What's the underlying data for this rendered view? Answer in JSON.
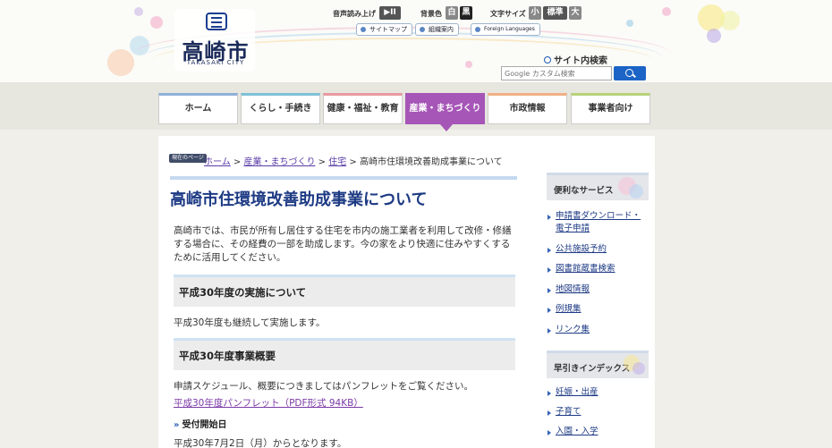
{
  "header": {
    "logo_jp": "高崎市",
    "logo_en": "TAKASAKI CITY",
    "utilities": {
      "speech_label": "音声読み上げ",
      "speech_btn": "▶II",
      "bg_label": "背景色",
      "bg_white": "白",
      "bg_black": "黒",
      "font_label": "文字サイズ",
      "font_small": "小",
      "font_std": "標準",
      "font_large": "大"
    },
    "links": [
      "サイトマップ",
      "組織案内",
      "Foreign Languages"
    ],
    "search_title": "サイト内検索",
    "search_placeholder": "Google カスタム検索"
  },
  "nav": [
    {
      "label": "ホーム",
      "color": "#8fb1d8"
    },
    {
      "label": "くらし・手続き",
      "color": "#7fc0d6"
    },
    {
      "label": "健康・福祉・教育",
      "color": "#e99aa0"
    },
    {
      "label": "産業・まちづくり",
      "color": "#a656b7",
      "active": true
    },
    {
      "label": "市政情報",
      "color": "#efb083"
    },
    {
      "label": "事業者向け",
      "color": "#b9d27a"
    }
  ],
  "breadcrumb": {
    "badge": "現在のページ",
    "items": [
      "ホーム",
      "産業・まちづくり",
      "住宅"
    ],
    "current": "高崎市住環境改善助成事業について"
  },
  "content": {
    "title": "高崎市住環境改善助成事業について",
    "intro": "高崎市では、市民が所有し居住する住宅を市内の施工業者を利用して改修・修繕する場合に、その経費の一部を助成します。今の家をより快適に住みやすくするために活用してください。",
    "section1_title": "平成30年度の実施について",
    "section1_text": "平成30年度も継続して実施します。",
    "section2_title": "平成30年度事業概要",
    "section2_text": "申請スケジュール、概要につきましてはパンフレットをご覧ください。",
    "pdf_link": "平成30年度パンフレット（PDF形式 94KB）",
    "sub_title": "受付開始日",
    "sub_text": "平成30年7月2日（月）からとなります。"
  },
  "sidebar": {
    "services_title": "便利なサービス",
    "services": [
      "申請書ダウンロード・電子申請",
      "公共施設予約",
      "図書館蔵書検索",
      "地図情報",
      "例規集",
      "リンク集"
    ],
    "index_title": "早引きインデックス",
    "index": [
      "妊娠・出産",
      "子育て",
      "入園・入学"
    ]
  }
}
